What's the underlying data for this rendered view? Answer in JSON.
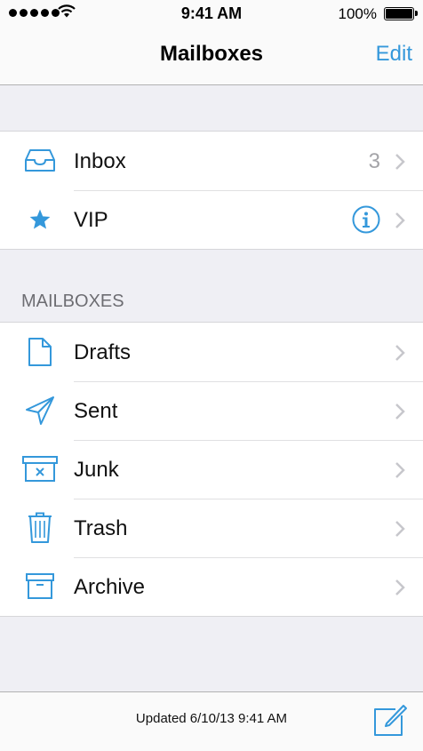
{
  "status_bar": {
    "time": "9:41 AM",
    "battery_percent": "100%"
  },
  "nav": {
    "title": "Mailboxes",
    "edit_label": "Edit"
  },
  "accent_color": "#3498db",
  "top_items": [
    {
      "label": "Inbox",
      "icon": "inbox-icon",
      "count": "3"
    },
    {
      "label": "VIP",
      "icon": "star-icon"
    }
  ],
  "mailboxes_section": {
    "header": "MAILBOXES",
    "items": [
      {
        "label": "Drafts",
        "icon": "document-icon"
      },
      {
        "label": "Sent",
        "icon": "paper-plane-icon"
      },
      {
        "label": "Junk",
        "icon": "junk-bin-icon"
      },
      {
        "label": "Trash",
        "icon": "trash-can-icon"
      },
      {
        "label": "Archive",
        "icon": "archive-box-icon"
      }
    ]
  },
  "toolbar": {
    "updated_text": "Updated 6/10/13 9:41 AM"
  }
}
